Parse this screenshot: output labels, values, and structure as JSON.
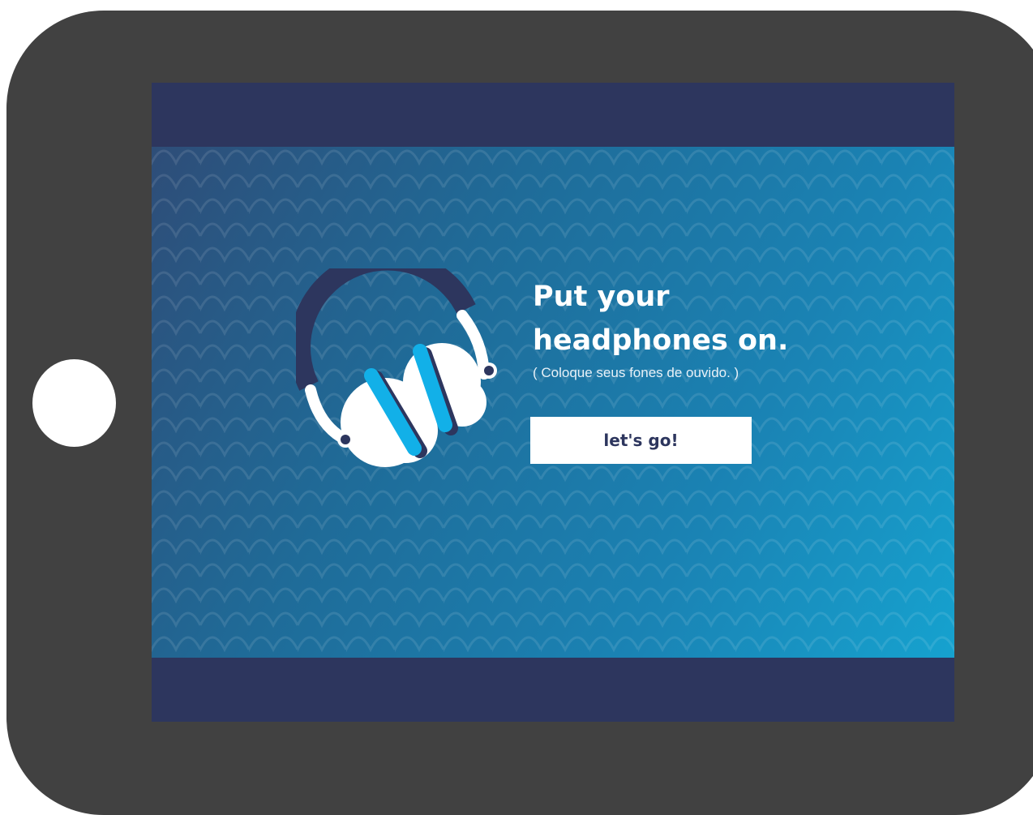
{
  "intro": {
    "title_line1": "Put your",
    "title_line2": "headphones on.",
    "subtitle": "( Coloque seus fones de ouvido. )",
    "button_label": "let's go!",
    "illustration_icon": "headphones-icon"
  },
  "colors": {
    "device_frame": "#414141",
    "home_button": "#ffffff",
    "screen_bar": "#2d365e",
    "content_gradient_start": "#2e4d78",
    "content_gradient_end": "#16a2cf",
    "headphone_band": "#2d365e",
    "headphone_accent": "#12b0e8",
    "button_background": "#ffffff",
    "button_text": "#2d365e"
  }
}
